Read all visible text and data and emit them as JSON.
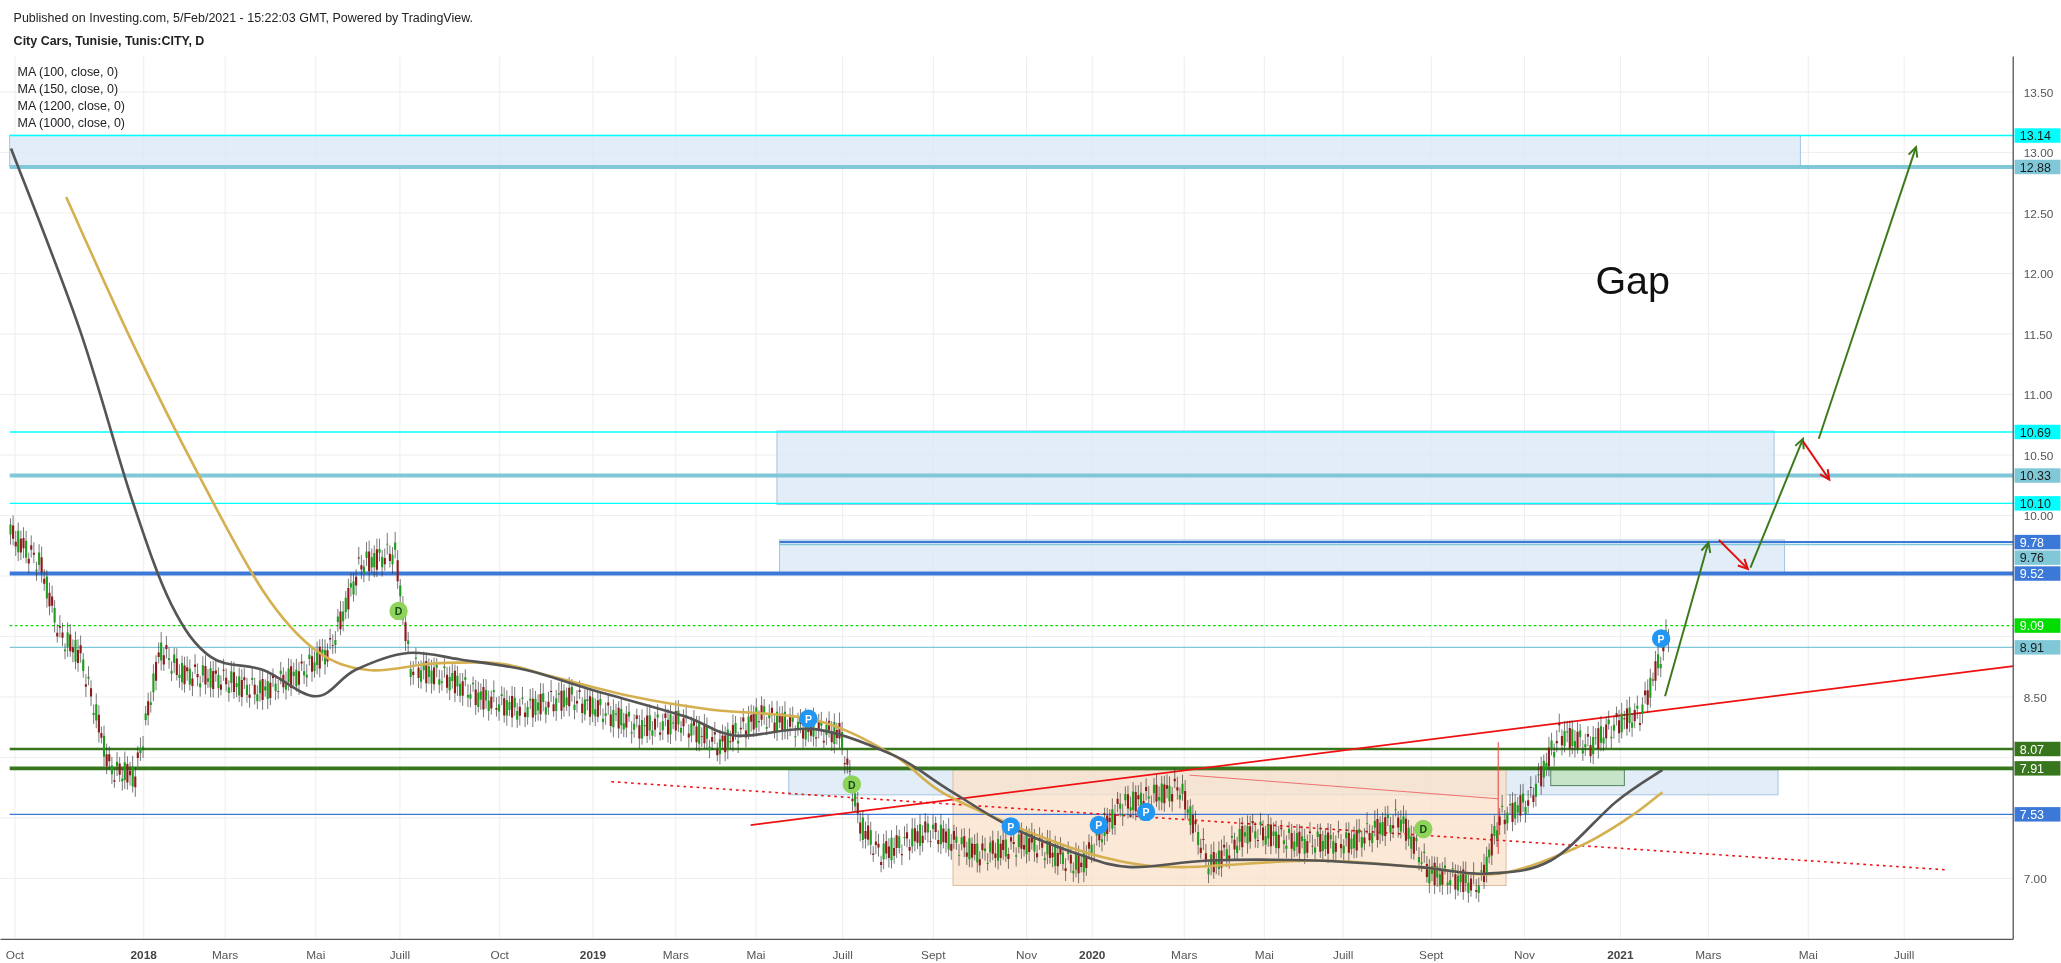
{
  "header": {
    "published": "Published on Investing.com, 5/Feb/2021 - 15:22:03 GMT, Powered by TradingView.",
    "title": "City Cars, Tunisie, Tunis:CITY, D"
  },
  "legend": [
    "MA (100, close, 0)",
    "MA (150, close, 0)",
    "MA (1200, close, 0)",
    "MA (1000, close, 0)"
  ],
  "annotation": "Gap",
  "markers": [
    {
      "letter": "D",
      "kind": "dividend"
    },
    {
      "letter": "D",
      "kind": "dividend"
    },
    {
      "letter": "D",
      "kind": "dividend"
    },
    {
      "letter": "P",
      "kind": "pivot"
    },
    {
      "letter": "P",
      "kind": "pivot"
    },
    {
      "letter": "P",
      "kind": "pivot"
    },
    {
      "letter": "P",
      "kind": "pivot"
    },
    {
      "letter": "P",
      "kind": "pivot"
    }
  ],
  "y_axis": {
    "ticks": [
      "13.50",
      "13.00",
      "12.50",
      "12.00",
      "11.50",
      "11.00",
      "10.50",
      "10.00",
      "8.50",
      "7.00"
    ]
  },
  "price_labels": [
    {
      "text": "13.14",
      "color": "#00ffff"
    },
    {
      "text": "12.88",
      "color": "#80c8d8"
    },
    {
      "text": "10.69",
      "color": "#00ffff"
    },
    {
      "text": "10.33",
      "color": "#80c8d8"
    },
    {
      "text": "10.10",
      "color": "#00ffff"
    },
    {
      "text": "9.78",
      "color": "#3c78d8"
    },
    {
      "text": "9.76",
      "color": "#80c8d8"
    },
    {
      "text": "9.52",
      "color": "#3c78d8"
    },
    {
      "text": "9.09",
      "color": "#00dd00"
    },
    {
      "text": "8.91",
      "color": "#80c8d8"
    },
    {
      "text": "8.07",
      "color": "#38761d"
    },
    {
      "text": "7.91",
      "color": "#38761d"
    },
    {
      "text": "7.53",
      "color": "#3c78d8"
    }
  ],
  "x_axis": {
    "labels": [
      {
        "text": "Oct",
        "kind": "month"
      },
      {
        "text": "2018",
        "kind": "year"
      },
      {
        "text": "Mars",
        "kind": "month"
      },
      {
        "text": "Mai",
        "kind": "month"
      },
      {
        "text": "Juill",
        "kind": "month"
      },
      {
        "text": "Oct",
        "kind": "month"
      },
      {
        "text": "2019",
        "kind": "year"
      },
      {
        "text": "Mars",
        "kind": "month"
      },
      {
        "text": "Mai",
        "kind": "month"
      },
      {
        "text": "Juill",
        "kind": "month"
      },
      {
        "text": "Sept",
        "kind": "month"
      },
      {
        "text": "Nov",
        "kind": "month"
      },
      {
        "text": "2020",
        "kind": "year"
      },
      {
        "text": "Mars",
        "kind": "month"
      },
      {
        "text": "Mai",
        "kind": "month"
      },
      {
        "text": "Juill",
        "kind": "month"
      },
      {
        "text": "Sept",
        "kind": "month"
      },
      {
        "text": "Nov",
        "kind": "month"
      },
      {
        "text": "2021",
        "kind": "year"
      },
      {
        "text": "Mars",
        "kind": "month"
      },
      {
        "text": "Mai",
        "kind": "month"
      },
      {
        "text": "Juill",
        "kind": "month"
      }
    ]
  }
}
